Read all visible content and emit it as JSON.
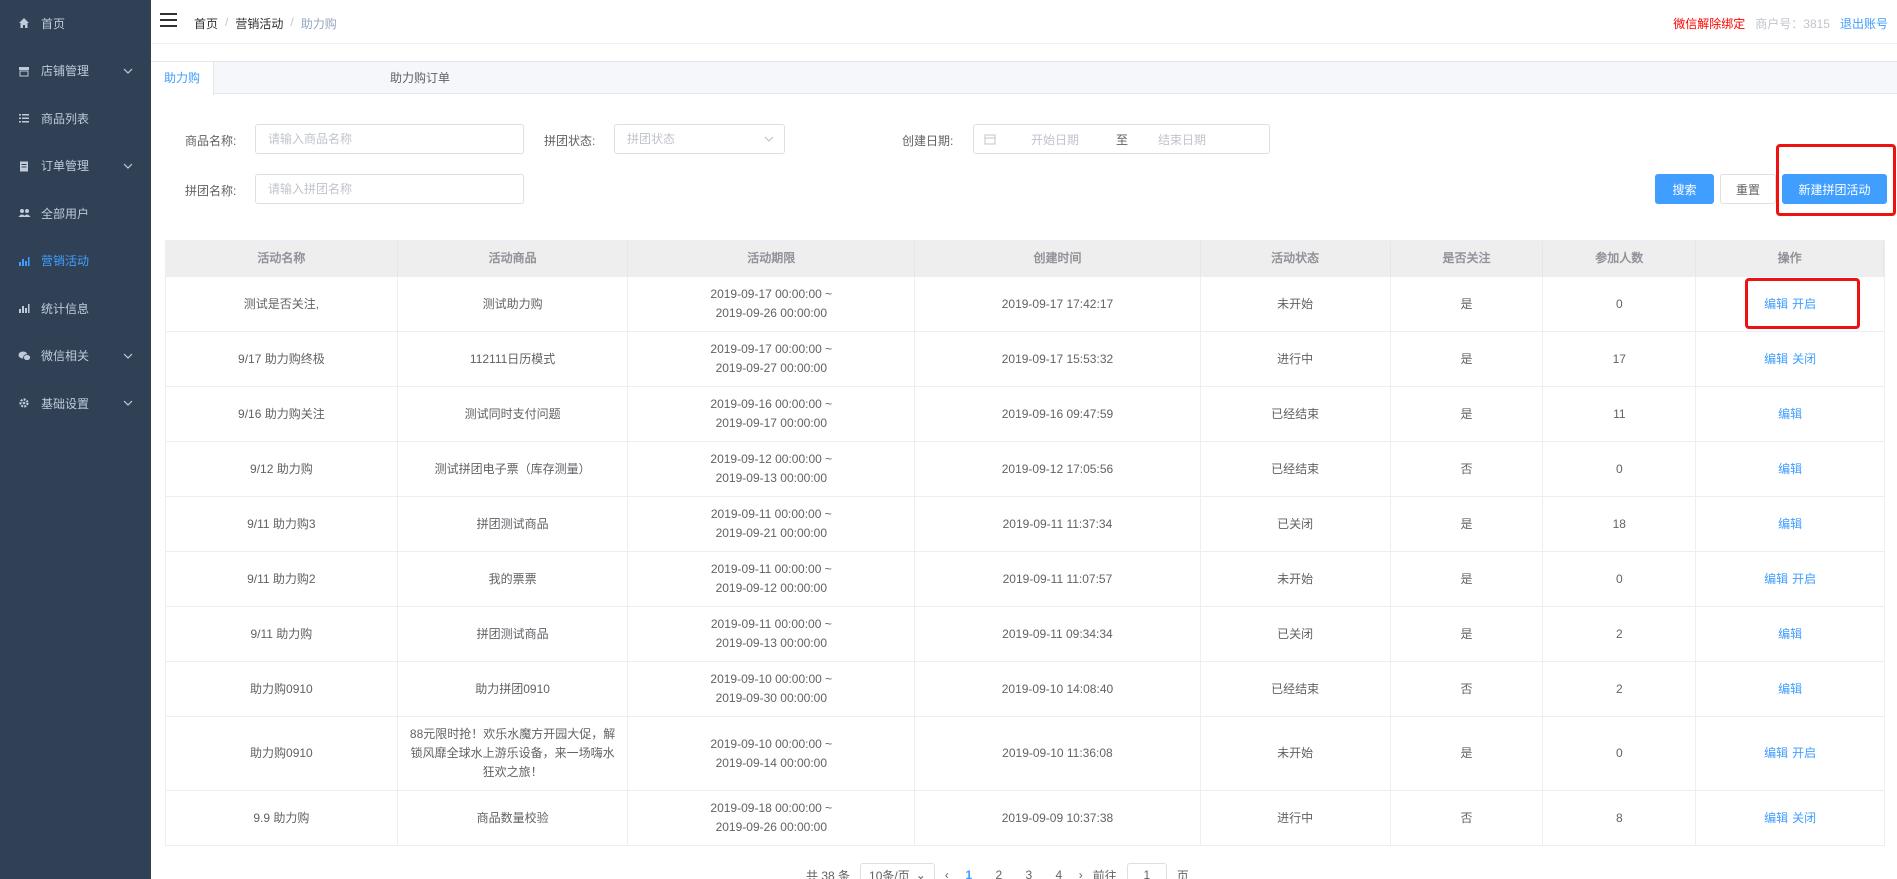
{
  "sidebar": {
    "items": [
      {
        "label": "首页",
        "icon": "home-icon",
        "chevron": false
      },
      {
        "label": "店铺管理",
        "icon": "store-icon",
        "chevron": true
      },
      {
        "label": "商品列表",
        "icon": "list-icon",
        "chevron": false
      },
      {
        "label": "订单管理",
        "icon": "clipboard-icon",
        "chevron": true
      },
      {
        "label": "全部用户",
        "icon": "users-icon",
        "chevron": false
      },
      {
        "label": "营销活动",
        "icon": "chart-icon",
        "chevron": false,
        "active": true
      },
      {
        "label": "统计信息",
        "icon": "stats-icon",
        "chevron": false
      },
      {
        "label": "微信相关",
        "icon": "wechat-icon",
        "chevron": true
      },
      {
        "label": "基础设置",
        "icon": "gear-icon",
        "chevron": true
      }
    ]
  },
  "header": {
    "breadcrumb": [
      "首页",
      "营销活动",
      "助力购"
    ],
    "unbind": "微信解除绑定",
    "merchant": "商户号：3815",
    "logout": "退出账号"
  },
  "tabs": [
    "助力购",
    "助力购订单"
  ],
  "filters": {
    "goods_label": "商品名称:",
    "goods_placeholder": "请输入商品名称",
    "status_label": "拼团状态:",
    "status_placeholder": "拼团状态",
    "date_label": "创建日期:",
    "start_placeholder": "开始日期",
    "range_sep": "至",
    "end_placeholder": "结束日期",
    "group_label": "拼团名称:",
    "group_placeholder": "请输入拼团名称",
    "search": "搜索",
    "reset": "重置",
    "create": "新建拼团活动"
  },
  "table": {
    "headers": [
      "活动名称",
      "活动商品",
      "活动期限",
      "创建时间",
      "活动状态",
      "是否关注",
      "参加人数",
      "操作"
    ],
    "rows": [
      {
        "name": "测试是否关注,",
        "goods": "测试助力购",
        "start": "2019-09-17 00:00:00 ~",
        "end": "2019-09-26 00:00:00",
        "created": "2019-09-17 17:42:17",
        "status": "未开始",
        "follow": "是",
        "count": "0",
        "ops": [
          "编辑",
          "开启"
        ]
      },
      {
        "name": "9/17 助力购终极",
        "goods": "112111日历模式",
        "start": "2019-09-17 00:00:00 ~",
        "end": "2019-09-27 00:00:00",
        "created": "2019-09-17 15:53:32",
        "status": "进行中",
        "follow": "是",
        "count": "17",
        "ops": [
          "编辑",
          "关闭"
        ]
      },
      {
        "name": "9/16 助力购关注",
        "goods": "测试同时支付问题",
        "start": "2019-09-16 00:00:00 ~",
        "end": "2019-09-17 00:00:00",
        "created": "2019-09-16 09:47:59",
        "status": "已经结束",
        "follow": "是",
        "count": "11",
        "ops": [
          "编辑"
        ]
      },
      {
        "name": "9/12 助力购",
        "goods": "测试拼团电子票（库存测量）",
        "start": "2019-09-12 00:00:00 ~",
        "end": "2019-09-13 00:00:00",
        "created": "2019-09-12 17:05:56",
        "status": "已经结束",
        "follow": "否",
        "count": "0",
        "ops": [
          "编辑"
        ]
      },
      {
        "name": "9/11 助力购3",
        "goods": "拼团测试商品",
        "start": "2019-09-11 00:00:00 ~",
        "end": "2019-09-21 00:00:00",
        "created": "2019-09-11 11:37:34",
        "status": "已关闭",
        "follow": "是",
        "count": "18",
        "ops": [
          "编辑"
        ]
      },
      {
        "name": "9/11 助力购2",
        "goods": "我的票票",
        "start": "2019-09-11 00:00:00 ~",
        "end": "2019-09-12 00:00:00",
        "created": "2019-09-11 11:07:57",
        "status": "未开始",
        "follow": "是",
        "count": "0",
        "ops": [
          "编辑",
          "开启"
        ]
      },
      {
        "name": "9/11 助力购",
        "goods": "拼团测试商品",
        "start": "2019-09-11 00:00:00 ~",
        "end": "2019-09-13 00:00:00",
        "created": "2019-09-11 09:34:34",
        "status": "已关闭",
        "follow": "是",
        "count": "2",
        "ops": [
          "编辑"
        ]
      },
      {
        "name": "助力购0910",
        "goods": "助力拼团0910",
        "start": "2019-09-10 00:00:00 ~",
        "end": "2019-09-30 00:00:00",
        "created": "2019-09-10 14:08:40",
        "status": "已经结束",
        "follow": "否",
        "count": "2",
        "ops": [
          "编辑"
        ]
      },
      {
        "name": "助力购0910",
        "goods": "88元限时抢！欢乐水魔方开园大促，解锁风靡全球水上游乐设备，来一场嗨水狂欢之旅！",
        "start": "2019-09-10 00:00:00 ~",
        "end": "2019-09-14 00:00:00",
        "created": "2019-09-10 11:36:08",
        "status": "未开始",
        "follow": "是",
        "count": "0",
        "ops": [
          "编辑",
          "开启"
        ]
      },
      {
        "name": "9.9 助力购",
        "goods": "商品数量校验",
        "start": "2019-09-18 00:00:00 ~",
        "end": "2019-09-26 00:00:00",
        "created": "2019-09-09 10:37:38",
        "status": "进行中",
        "follow": "否",
        "count": "8",
        "ops": [
          "编辑",
          "关闭"
        ]
      }
    ]
  },
  "pagination": {
    "total": "共 38 条",
    "size": "10条/页",
    "pages": [
      "1",
      "2",
      "3",
      "4"
    ],
    "current": "1",
    "goto_label": "前往",
    "goto_value": "1",
    "page_unit": "页"
  },
  "colors": {
    "sidebar_bg": "#304156",
    "accent": "#409eff",
    "highlight_box": "#ee1111"
  }
}
